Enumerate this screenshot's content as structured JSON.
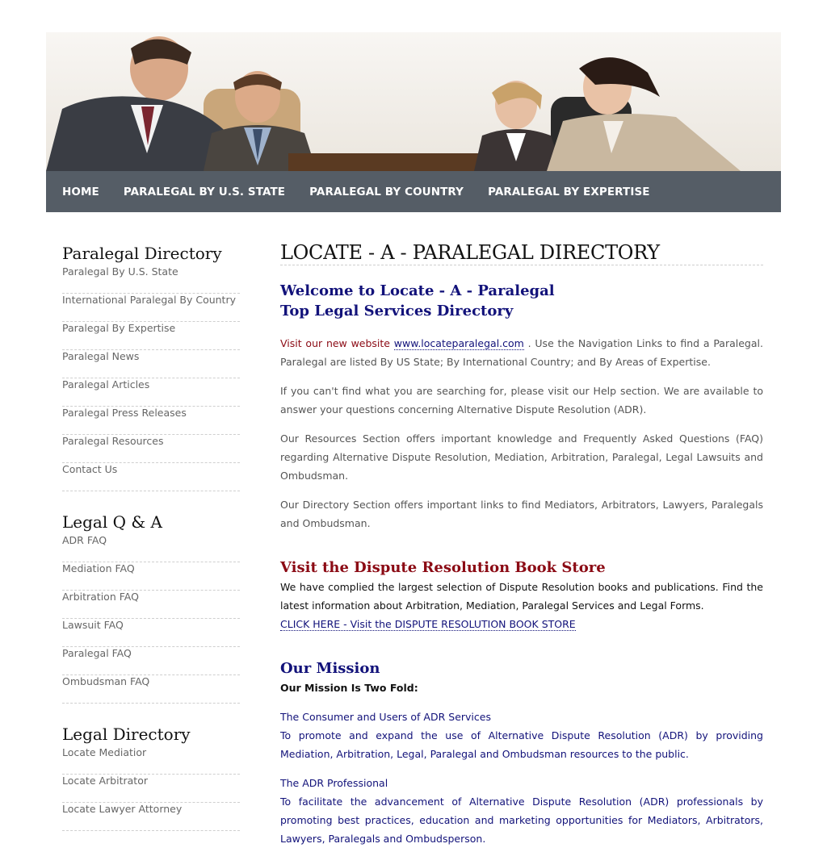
{
  "nav": {
    "items": [
      "HOME",
      "PARALEGAL BY U.S. STATE",
      "PARALEGAL BY COUNTRY",
      "PARALEGAL BY EXPERTISE"
    ]
  },
  "sidebar": {
    "groups": [
      {
        "title": "Paralegal Directory",
        "items": [
          "Paralegal By U.S. State",
          "International Paralegal By Country",
          "Paralegal By Expertise",
          "Paralegal News",
          "Paralegal Articles",
          "Paralegal Press Releases",
          "Paralegal Resources",
          "Contact Us"
        ]
      },
      {
        "title": "Legal Q & A",
        "items": [
          "ADR FAQ",
          "Mediation FAQ",
          "Arbitration FAQ",
          "Lawsuit FAQ",
          "Paralegal FAQ",
          "Ombudsman FAQ"
        ]
      },
      {
        "title": "Legal Directory",
        "items": [
          "Locate Mediatior",
          "Locate Arbitrator",
          "Locate Lawyer Attorney"
        ]
      }
    ]
  },
  "main": {
    "heading": "LOCATE - A - PARALEGAL DIRECTORY",
    "welcome_line1": "Welcome to Locate - A - Paralegal",
    "welcome_line2": "Top Legal Services Directory",
    "visit_prefix": "Visit our new website",
    "visit_link": "www.locateparalegal.com",
    "visit_rest": ". Use the Navigation Links to find a Paralegal. Paralegal are listed By US State; By International Country; and By Areas of Expertise.",
    "para2": "If you can't find what you are searching for, please visit our Help section. We are available to answer your questions concerning Alternative Dispute Resolution (ADR).",
    "para3": "Our Resources Section offers important knowledge and Frequently Asked Questions (FAQ) regarding Alternative Dispute Resolution, Mediation, Arbitration, Paralegal, Legal Lawsuits and Ombudsman.",
    "para4": "Our Directory Section offers important links to find Mediators, Arbitrators, Lawyers, Paralegals and Ombudsman.",
    "bookstore_title": "Visit the Dispute Resolution Book Store",
    "bookstore_text": "We have complied the largest selection of Dispute Resolution books and publications. Find the latest information about Arbitration, Mediation, Paralegal Services and Legal Forms.",
    "bookstore_link": "CLICK HERE - Visit the DISPUTE RESOLUTION BOOK STORE",
    "mission_title": "Our Mission",
    "mission_sub": "Our Mission Is Two Fold:",
    "consumer_title": "The Consumer and Users of ADR Services",
    "consumer_text": "To promote and expand the use of Alternative Dispute Resolution (ADR) by providing Mediation, Arbitration, Legal, Paralegal and Ombudsman resources to the public.",
    "pro_title": "The ADR Professional",
    "pro_text": "To facilitate the advancement of Alternative Dispute Resolution (ADR) professionals by promoting best practices, education and marketing opportunities for Mediators, Arbitrators, Lawyers, Paralegals and Ombudsperson."
  },
  "colors": {
    "nav_bg": "#555d66",
    "navy": "#12127a",
    "maroon": "#8b0a14"
  }
}
